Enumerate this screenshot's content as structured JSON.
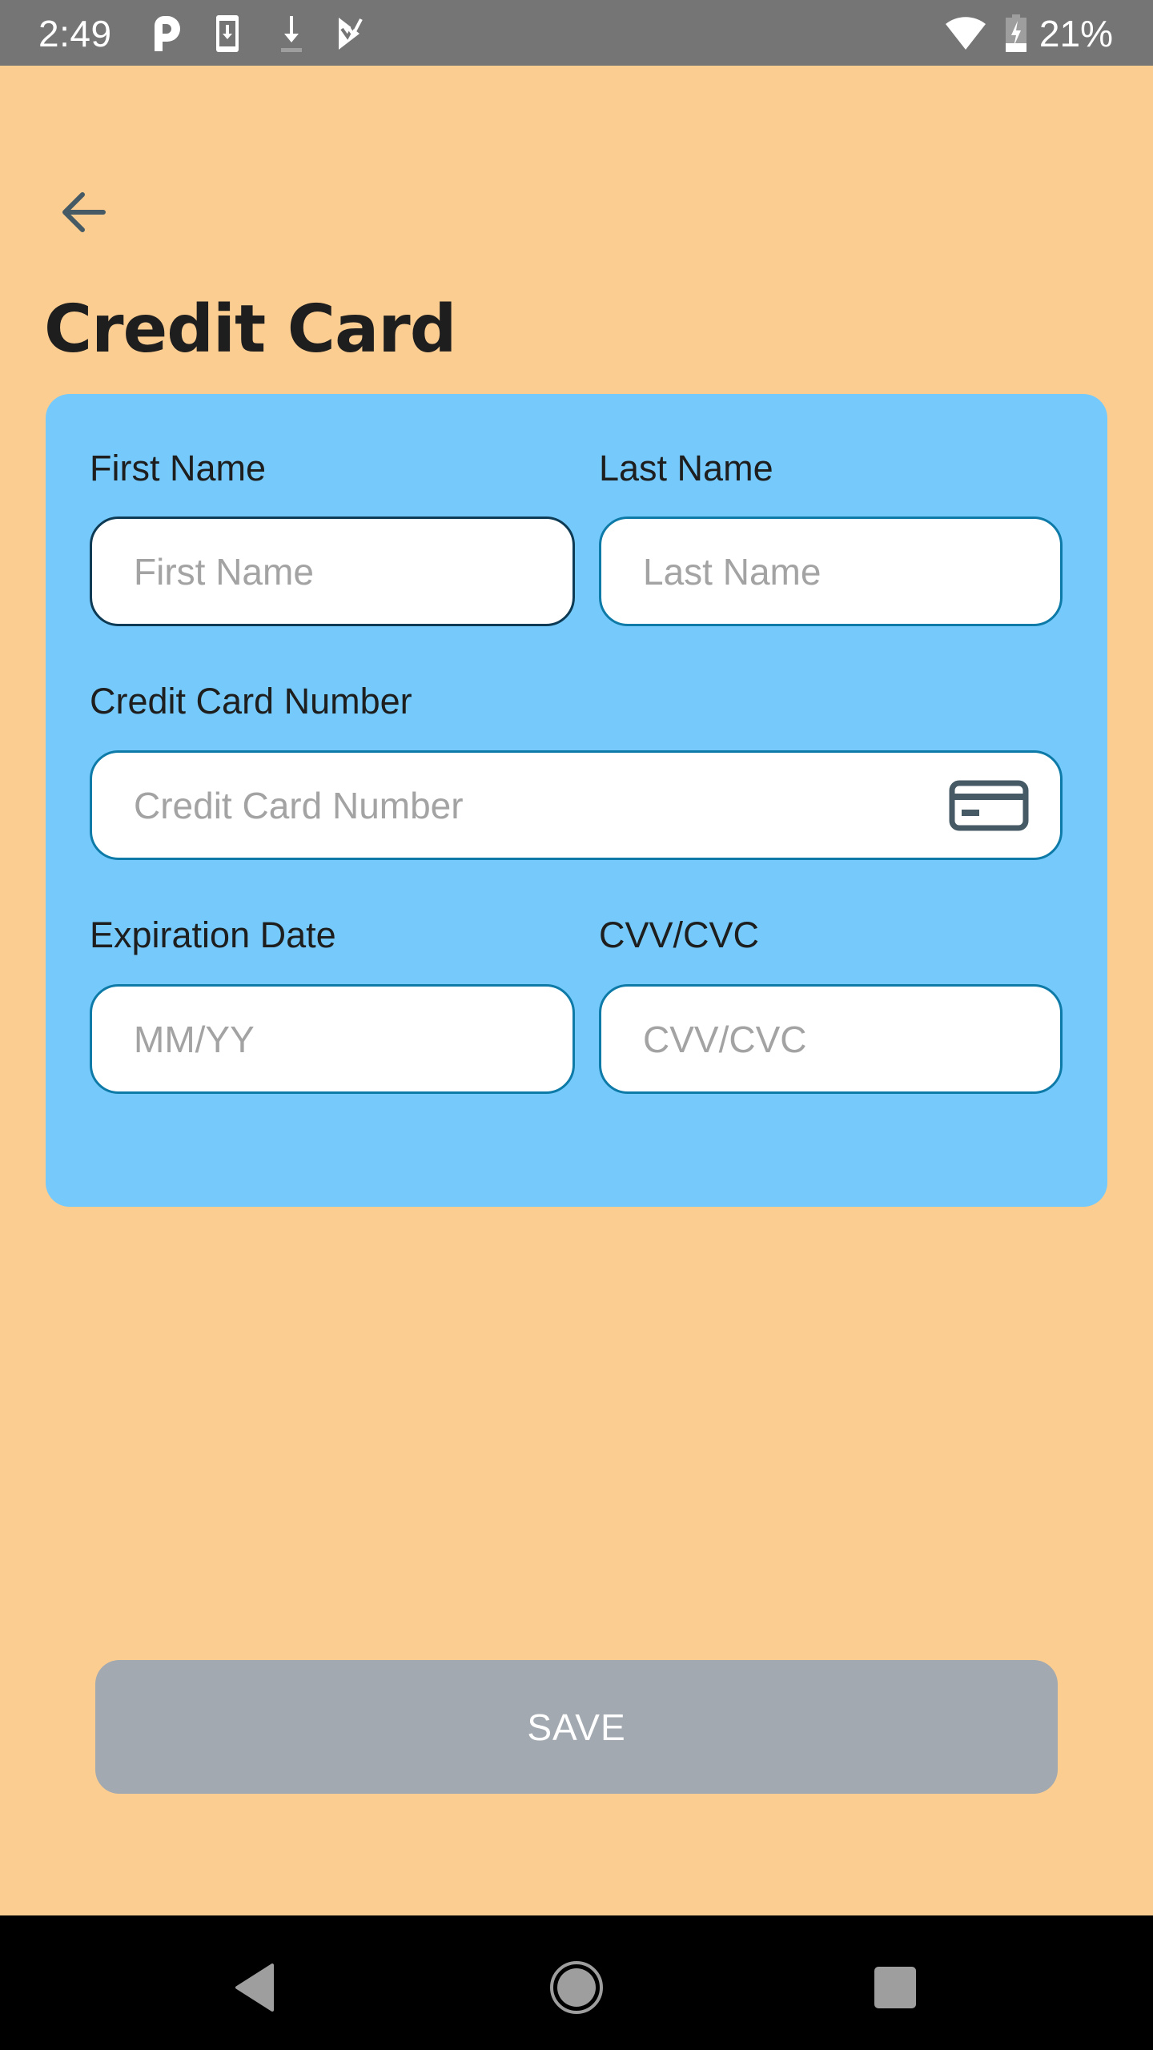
{
  "status_bar": {
    "time": "2:49",
    "notification_icons": [
      "parking-app-icon",
      "phone-download-icon",
      "download-icon",
      "task-check-icon"
    ],
    "wifi_icon": "wifi-icon",
    "battery_icon": "battery-charging-icon",
    "battery_percent": "21%"
  },
  "header": {
    "back_icon": "arrow-left-icon",
    "title": "Credit Card"
  },
  "form": {
    "first_name": {
      "label": "First Name",
      "placeholder": "First Name",
      "value": ""
    },
    "last_name": {
      "label": "Last Name",
      "placeholder": "Last Name",
      "value": ""
    },
    "card_number": {
      "label": "Credit Card Number",
      "placeholder": "Credit Card Number",
      "value": "",
      "icon": "credit-card-icon"
    },
    "expiration": {
      "label": "Expiration Date",
      "placeholder": "MM/YY",
      "value": ""
    },
    "cvv": {
      "label": "CVV/CVC",
      "placeholder": "CVV/CVC",
      "value": ""
    }
  },
  "actions": {
    "save_label": "SAVE"
  },
  "colors": {
    "background": "#FCCD91",
    "card": "#75CAFB",
    "input_border": "#0D7AA8",
    "input_border_focused": "#0D3A54",
    "save_button_disabled": "#A2A9B0",
    "status_bar": "#757575"
  },
  "nav_bar": {
    "back": "nav-back-icon",
    "home": "nav-home-icon",
    "recents": "nav-recents-icon"
  }
}
